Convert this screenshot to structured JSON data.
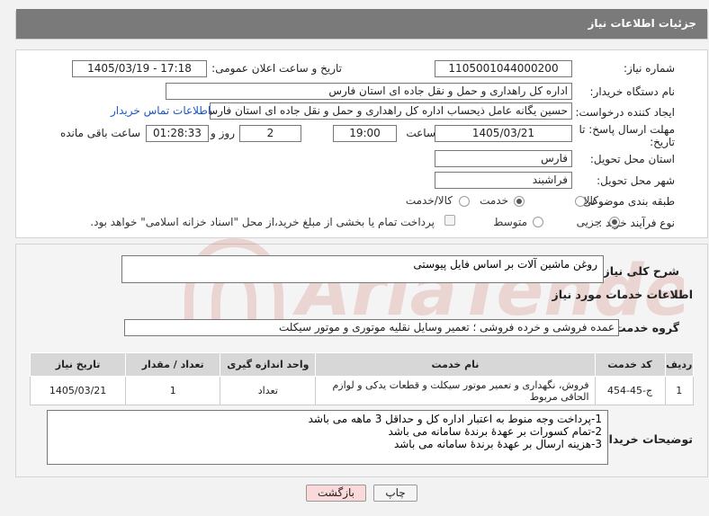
{
  "header": {
    "title": "جزئیات اطلاعات نیاز"
  },
  "form": {
    "need_number_label": "شماره نیاز:",
    "need_number": "1105001044000200",
    "announce_label": "تاریخ و ساعت اعلان عمومی:",
    "announce_value": "1405/03/19 - 17:18",
    "buyer_org_label": "نام دستگاه خریدار:",
    "buyer_org": "اداره کل راهداری و حمل و نقل جاده ای استان فارس",
    "requester_label": "ایجاد کننده درخواست:",
    "requester": "حسین یگانه عامل ذیحساب اداره کل راهداری و حمل و نقل جاده ای استان فارس",
    "contact_link": "اطلاعات تماس خریدار",
    "deadline_label_1": "مهلت ارسال پاسخ: تا",
    "deadline_label_2": "تاریخ:",
    "deadline_date": "1405/03/21",
    "time_label": "ساعت",
    "deadline_time": "19:00",
    "days_value": "2",
    "days_label": "روز و",
    "remaining_value": "01:28:33",
    "remaining_label": "ساعت باقی مانده",
    "province_label": "استان محل تحویل:",
    "province": "فارس",
    "city_label": "شهر محل تحویل:",
    "city": "فراشبند",
    "category_label": "طبقه بندی موضوعی:",
    "category_options": [
      "کالا",
      "خدمت",
      "کالا/خدمت"
    ],
    "category_selected": "خدمت",
    "process_label": "نوع فرآیند خرید :",
    "process_options": [
      "جزیی",
      "متوسط"
    ],
    "process_selected": "جزیی",
    "payment_note": "پرداخت تمام یا بخشی از مبلغ خرید،از محل \"اسناد خزانه اسلامی\" خواهد بود."
  },
  "summary": {
    "label": "شرح کلی نیاز:",
    "value": "روغن ماشین آلات بر اساس فایل پیوستی"
  },
  "services": {
    "section_title": "اطلاعات خدمات مورد نیاز",
    "group_label": "گروه خدمت:",
    "group_value": "عمده فروشی و خرده فروشی ؛ تعمیر وسایل نقلیه موتوری و موتور سیکلت",
    "columns": [
      "ردیف",
      "کد خدمت",
      "نام خدمت",
      "واحد اندازه گیری",
      "تعداد / مقدار",
      "تاریخ نیاز"
    ],
    "rows": [
      [
        "1",
        "ج-45-454",
        "فروش، نگهداری و تعمیر موتور سیکلت و قطعات یدکی و لوازم الحاقی مربوط",
        "تعداد",
        "1",
        "1405/03/21"
      ]
    ]
  },
  "buyer_notes": {
    "label": "توضیحات خریدار:",
    "value": "1-پرداخت وجه منوط به اعتبار اداره کل و حداقل 3 ماهه می باشد\n2-تمام کسورات بر عهدۀ برندۀ سامانه می باشد\n3-هزینه ارسال بر عهدۀ برندۀ سامانه می باشد"
  },
  "buttons": {
    "print": "چاپ",
    "back": "بازگشت"
  },
  "watermark": {
    "text": "AriaTender.neT"
  },
  "colors": {
    "header_bg": "#7a7a7a",
    "link": "#1a56c8",
    "back_btn": "#f9d9d9",
    "watermark": "#c0392b"
  }
}
